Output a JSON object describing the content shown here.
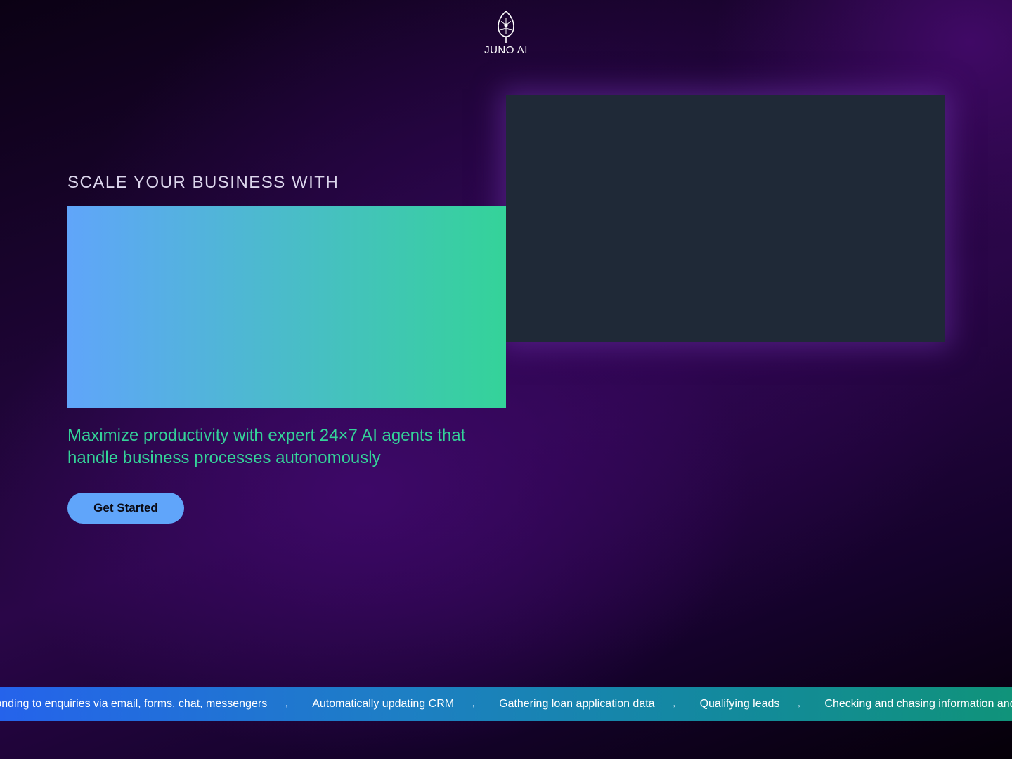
{
  "brand": {
    "name": "JUNO AI",
    "logo_icon": "leaf-circuit-icon"
  },
  "hero": {
    "eyebrow": "SCALE YOUR BUSINESS WITH",
    "subtitle": "Maximize productivity with expert 24×7 AI agents that handle business processes autonomously",
    "cta_label": "Get Started"
  },
  "ticker": {
    "arrow_icon": "arrow-right-icon",
    "items": [
      "Responding to enquiries via email, forms, chat, messengers",
      "Automatically updating CRM",
      "Gathering loan application data",
      "Qualifying leads",
      "Checking and chasing information and documents"
    ]
  },
  "colors": {
    "accent_blue": "#60a5fa",
    "accent_green": "#34d399",
    "panel": "#1f2937"
  }
}
